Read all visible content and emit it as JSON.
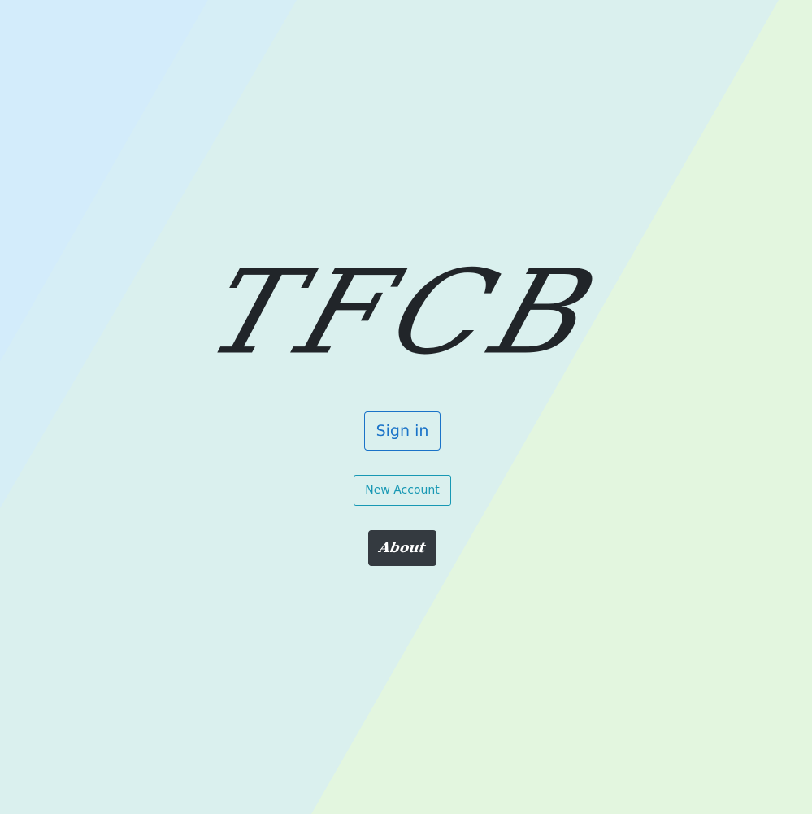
{
  "logo": {
    "text": "TFCB"
  },
  "buttons": {
    "sign_in": "Sign in",
    "new_account": "New Account",
    "about": "About"
  },
  "colors": {
    "background_left": "#d3ecfb",
    "background_middle": "#daf0ee",
    "background_right": "#e3f6df",
    "sign_in_accent": "#1a73c8",
    "new_account_accent": "#1798b4",
    "about_background": "#343a40",
    "logo_color": "#212529"
  }
}
